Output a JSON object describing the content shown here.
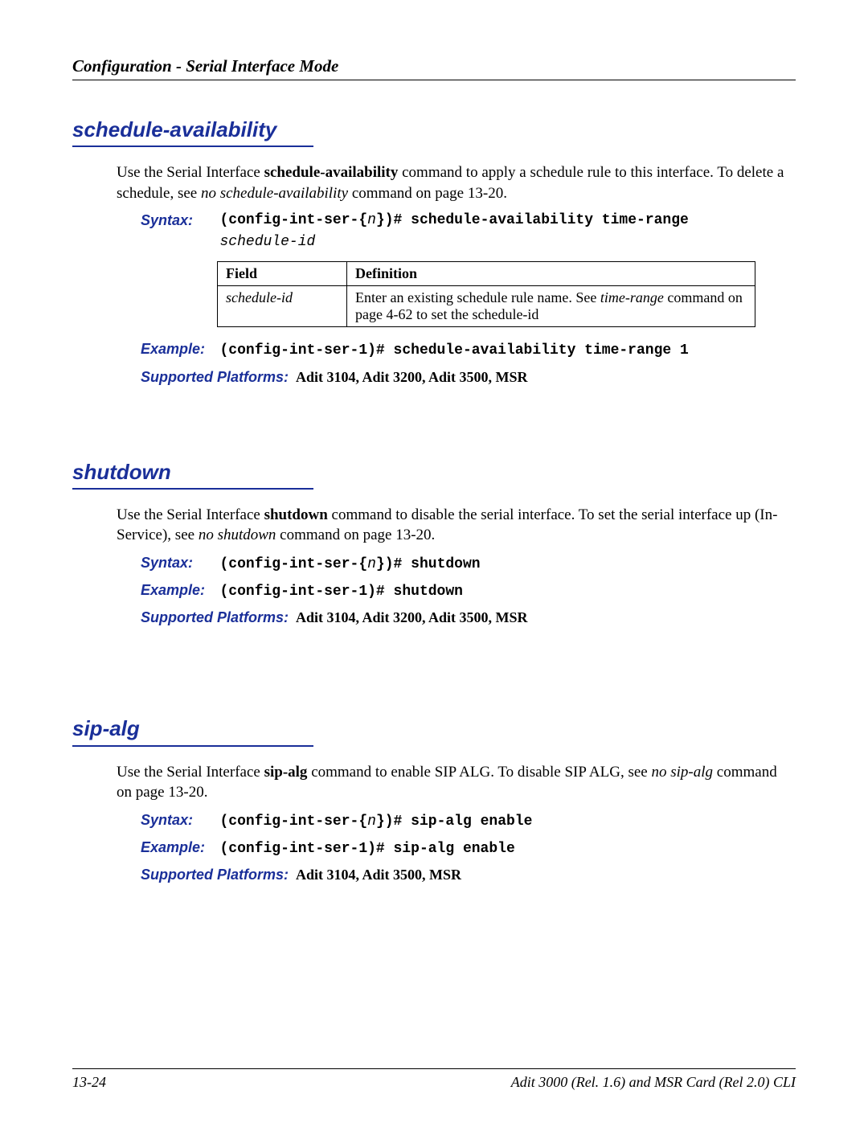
{
  "header": {
    "title": "Configuration - Serial Interface Mode"
  },
  "labels": {
    "syntax": "Syntax:",
    "example": "Example:",
    "platforms": "Supported Platforms:"
  },
  "sections": [
    {
      "title": "schedule-availability",
      "desc_parts": {
        "pre": "Use the Serial Interface ",
        "bold1": "schedule-availability",
        "mid": " command to apply a schedule rule to this interface. To delete a schedule, see ",
        "ital1": "no schedule-availability",
        "post": " command on page 13-20."
      },
      "syntax": {
        "prefix": "(config-int-ser-{",
        "n": "n",
        "close": "})# ",
        "cmd": "schedule-availability time-range",
        "extra_ital": "schedule-id"
      },
      "table": {
        "headers": {
          "field": "Field",
          "def": "Definition"
        },
        "row": {
          "field": "schedule-id",
          "def_pre": "Enter an existing schedule rule name. See ",
          "def_ital": "time-range",
          "def_post": " command on page 4-62 to set the schedule-id"
        }
      },
      "example": "(config-int-ser-1)# schedule-availability time-range 1",
      "platforms": "Adit 3104, Adit 3200, Adit 3500, MSR"
    },
    {
      "title": "shutdown",
      "desc_parts": {
        "pre": "Use the Serial Interface ",
        "bold1": "shutdown",
        "mid": " command to disable the serial interface. To set the serial interface up (In-Service), see ",
        "ital1": "no shutdown",
        "post": " command on page 13-20."
      },
      "syntax": {
        "prefix": "(config-int-ser-{",
        "n": "n",
        "close": "})# ",
        "cmd": "shutdown"
      },
      "example": "(config-int-ser-1)# shutdown",
      "platforms": "Adit 3104, Adit 3200, Adit 3500, MSR"
    },
    {
      "title": "sip-alg",
      "desc_parts": {
        "pre": "Use the Serial Interface ",
        "bold1": "sip-alg",
        "mid": " command to enable SIP ALG. To disable SIP ALG, see ",
        "ital1": "no sip-alg",
        "post": " command on page 13-20."
      },
      "syntax": {
        "prefix": "(config-int-ser-{",
        "n": "n",
        "close": "})# ",
        "cmd": "sip-alg enable"
      },
      "example": "(config-int-ser-1)# sip-alg enable",
      "platforms": "Adit 3104, Adit 3500, MSR"
    }
  ],
  "footer": {
    "page": "13-24",
    "doc": "Adit 3000 (Rel. 1.6) and MSR Card (Rel 2.0) CLI"
  }
}
